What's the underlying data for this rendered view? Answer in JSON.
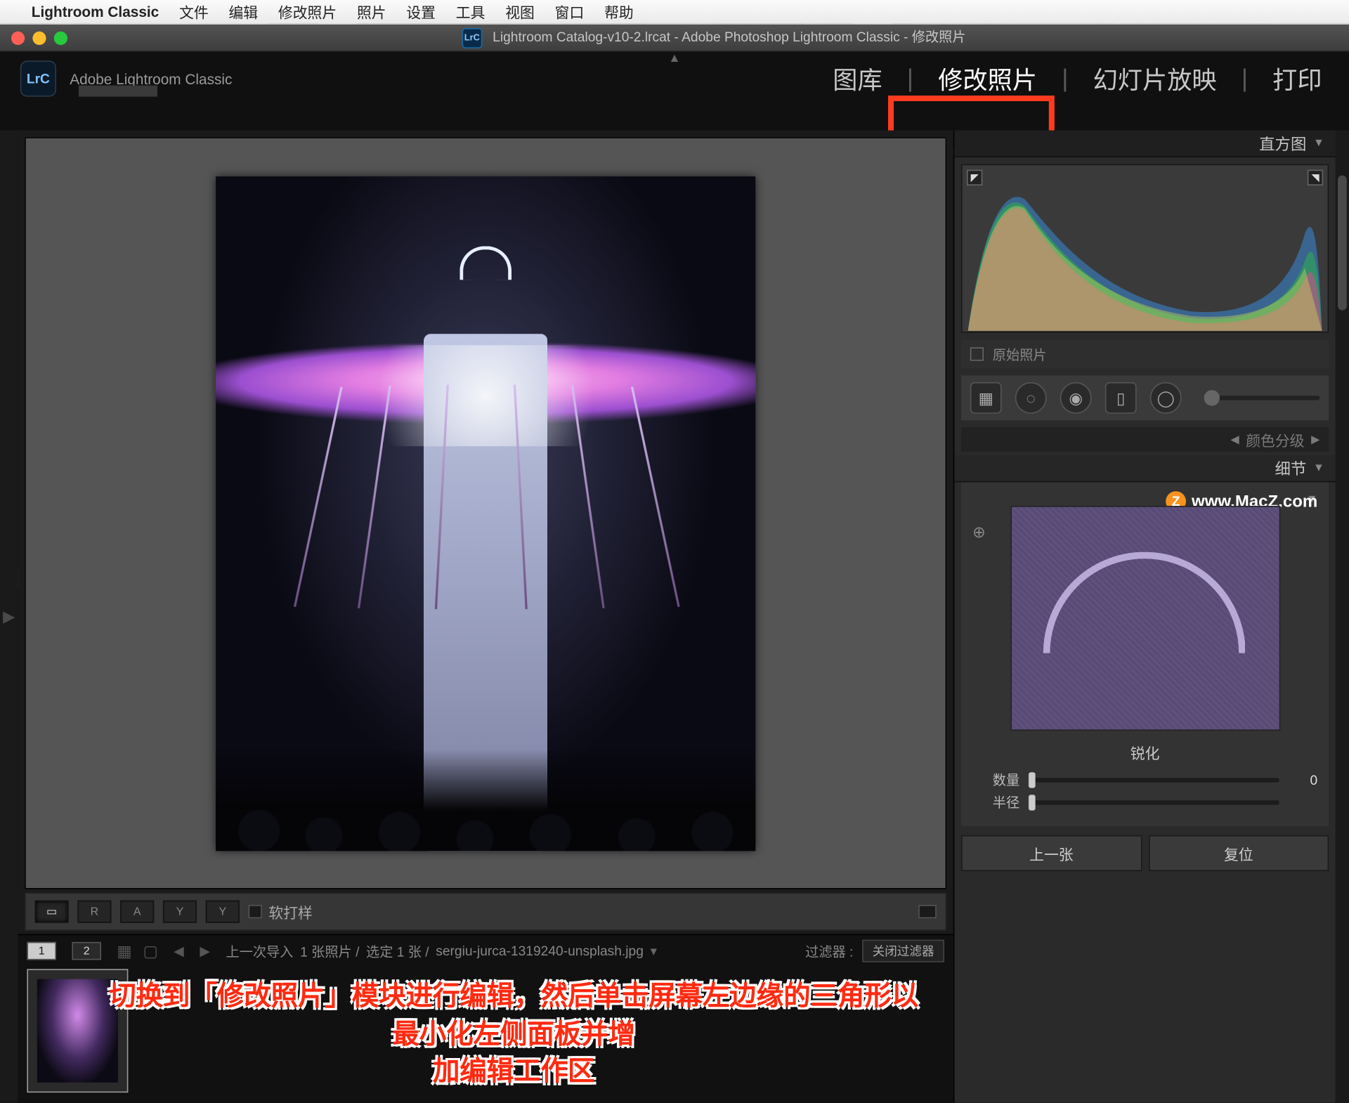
{
  "menubar": {
    "app": "Lightroom Classic",
    "items": [
      "文件",
      "编辑",
      "修改照片",
      "照片",
      "设置",
      "工具",
      "视图",
      "窗口",
      "帮助"
    ]
  },
  "window": {
    "title": "Lightroom Catalog-v10-2.lrcat - Adobe Photoshop Lightroom Classic - 修改照片",
    "badge": "LrC"
  },
  "identity": {
    "lrc": "LrC",
    "name": "Adobe Lightroom Classic"
  },
  "modules": {
    "library": "图库",
    "develop": "修改照片",
    "slideshow": "幻灯片放映",
    "print": "打印"
  },
  "toolbar": {
    "views": [
      "▭",
      "R",
      "A",
      "Y",
      "Y"
    ],
    "softproof": "软打样"
  },
  "filmstrip": {
    "monitors": [
      "1",
      "2"
    ],
    "path_a": "上一次导入",
    "path_b": "1 张照片 /",
    "path_c": "选定 1 张 /",
    "filename": "sergiu-jurca-1319240-unsplash.jpg",
    "filter_label": "过滤器 :",
    "filter_value": "关闭过滤器"
  },
  "right": {
    "histogram": "直方图",
    "original": "原始照片",
    "collapsed_label": "颜色分级",
    "detail": "细节",
    "sharpen_group": "锐化",
    "amount_label": "数量",
    "amount_value": "0",
    "radius_label": "半径",
    "prev": "上一张",
    "reset": "复位"
  },
  "watermark": "www.MacZ.com",
  "instruction": {
    "line1": "切换到「修改照片」模块进行编辑，然后单击屏幕左边缘的三角形以最小化左侧面板并增",
    "line2": "加编辑工作区"
  },
  "annotations": {
    "one": "1",
    "two": "2"
  }
}
